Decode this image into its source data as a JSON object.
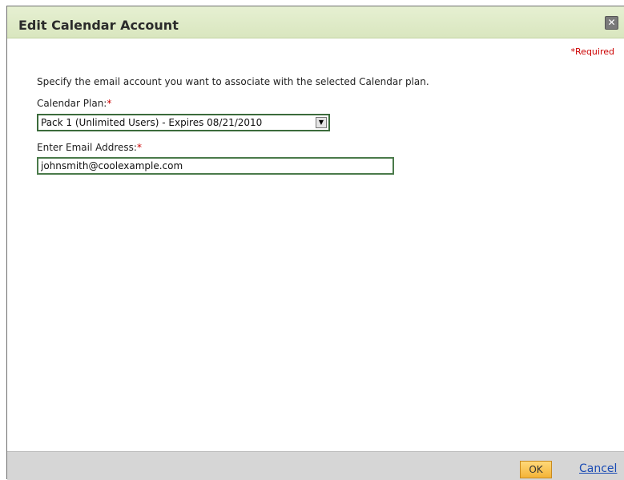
{
  "dialog": {
    "title": "Edit Calendar Account",
    "close_glyph": "✕",
    "required_note": "*Required",
    "instructions": "Specify the email account you want to associate with the selected Calendar plan.",
    "plan_label": "Calendar Plan:",
    "plan_required_mark": "*",
    "plan_selected": "Pack 1 (Unlimited Users) - Expires 08/21/2010",
    "plan_arrow_glyph": "▼",
    "email_label": "Enter Email Address:",
    "email_required_mark": "*",
    "email_value": "johnsmith@coolexample.com"
  },
  "footer": {
    "ok_label": "OK",
    "cancel_label": "Cancel"
  },
  "colors": {
    "titlebar": "#dde9c6",
    "required": "#cc0000",
    "ok_button": "#f4b337",
    "link": "#1a4bb4"
  }
}
